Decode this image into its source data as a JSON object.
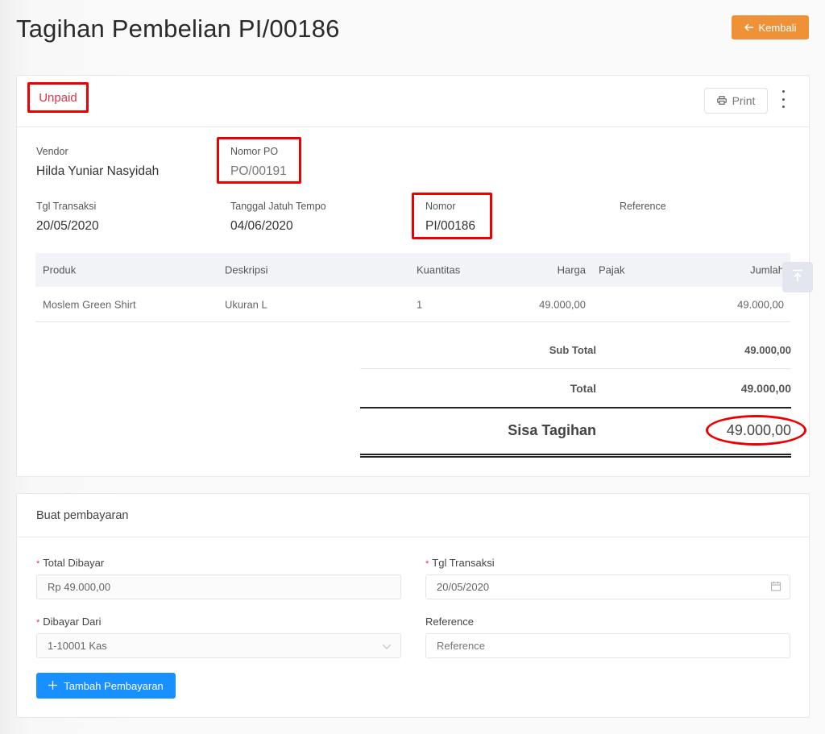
{
  "header": {
    "title": "Tagihan Pembelian PI/00186",
    "back_label": "Kembali"
  },
  "invoice": {
    "status": "Unpaid",
    "print_label": "Print",
    "vendor_label": "Vendor",
    "vendor_value": "Hilda Yuniar Nasyidah",
    "po_label": "Nomor PO",
    "po_value": "PO/00191",
    "trx_date_label": "Tgl Transaksi",
    "trx_date_value": "20/05/2020",
    "due_date_label": "Tanggal Jatuh Tempo",
    "due_date_value": "04/06/2020",
    "number_label": "Nomor",
    "number_value": "PI/00186",
    "reference_label": "Reference",
    "reference_value": ""
  },
  "table": {
    "headers": {
      "product": "Produk",
      "description": "Deskripsi",
      "quantity": "Kuantitas",
      "price": "Harga",
      "tax": "Pajak",
      "amount": "Jumlah"
    },
    "rows": [
      {
        "product": "Moslem Green Shirt",
        "description": "Ukuran L",
        "quantity": "1",
        "price": "49.000,00",
        "tax": "",
        "amount": "49.000,00"
      }
    ]
  },
  "totals": {
    "subtotal_label": "Sub Total",
    "subtotal_value": "49.000,00",
    "total_label": "Total",
    "total_value": "49.000,00",
    "balance_label": "Sisa Tagihan",
    "balance_value": "49.000,00"
  },
  "payment": {
    "title": "Buat pembayaran",
    "amount_label": "Total Dibayar",
    "amount_value": "Rp 49.000,00",
    "date_label": "Tgl Transaksi",
    "date_value": "20/05/2020",
    "account_label": "Dibayar Dari",
    "account_value": "1-10001 Kas",
    "reference_label": "Reference",
    "reference_placeholder": "Reference",
    "reference_value": "",
    "submit_label": "Tambah Pembayaran",
    "required_mark": "*"
  },
  "colors": {
    "accent_orange": "#ef9136",
    "primary_blue": "#1890ff",
    "unpaid_red": "#e0334a",
    "annotation_red": "#ee0000"
  }
}
